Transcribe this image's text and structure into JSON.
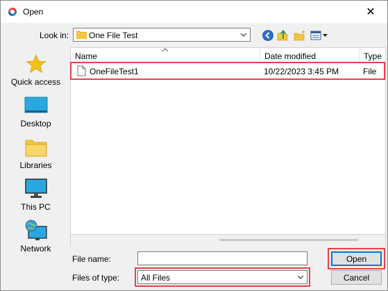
{
  "window": {
    "title": "Open",
    "close_glyph": "✕"
  },
  "toolbar": {
    "look_in_label": "Look in:",
    "look_in_value": "One File Test",
    "icons": [
      "back-icon",
      "up-folder-icon",
      "new-folder-icon",
      "view-menu-icon"
    ]
  },
  "places": [
    {
      "label": "Quick access",
      "icon": "star-icon"
    },
    {
      "label": "Desktop",
      "icon": "desktop-icon"
    },
    {
      "label": "Libraries",
      "icon": "libraries-icon"
    },
    {
      "label": "This PC",
      "icon": "this-pc-icon"
    },
    {
      "label": "Network",
      "icon": "network-icon"
    }
  ],
  "file_list": {
    "columns": [
      "Name",
      "Date modified",
      "Type"
    ],
    "rows": [
      {
        "name": "OneFileTest1",
        "date": "10/22/2023 3:45 PM",
        "type": "File"
      }
    ]
  },
  "form": {
    "file_name_label": "File name:",
    "file_name_value": "",
    "files_of_type_label": "Files of type:",
    "files_of_type_value": "All Files"
  },
  "buttons": {
    "open": "Open",
    "cancel": "Cancel"
  },
  "colors": {
    "highlight": "#e8414b",
    "accent": "#0078d7",
    "folder": "#f5c542"
  }
}
